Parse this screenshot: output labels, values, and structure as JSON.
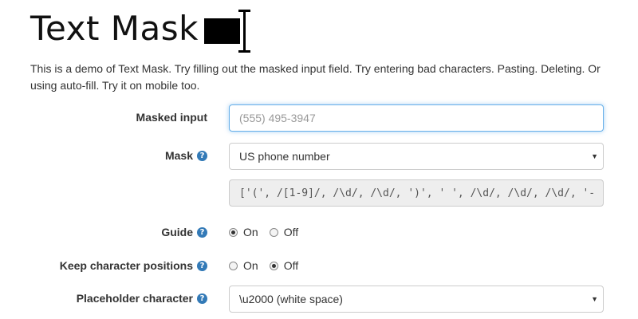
{
  "header": {
    "title": "Text Mask",
    "logo_icon": "text-cursor-icon"
  },
  "intro": {
    "text": "This is a demo of Text Mask. Try filling out the masked input field. Try entering bad characters. Pasting. Deleting. Or using auto-fill. Try it on mobile too."
  },
  "form": {
    "masked_input": {
      "label": "Masked input",
      "placeholder": "(555) 495-3947",
      "value": ""
    },
    "mask": {
      "label": "Mask",
      "selected": "US phone number",
      "code": "['(', /[1-9]/, /\\d/, /\\d/, ')', ' ', /\\d/, /\\d/, /\\d/, '-"
    },
    "guide": {
      "label": "Guide",
      "options": [
        "On",
        "Off"
      ],
      "selected": "On"
    },
    "keep_positions": {
      "label": "Keep character positions",
      "options": [
        "On",
        "Off"
      ],
      "selected": "Off"
    },
    "placeholder_char": {
      "label": "Placeholder character",
      "selected": "\\u2000 (white space)"
    }
  },
  "colors": {
    "help_icon": "#337ab7",
    "focus_border": "#66afe9",
    "readonly_bg": "#eeeeee"
  }
}
